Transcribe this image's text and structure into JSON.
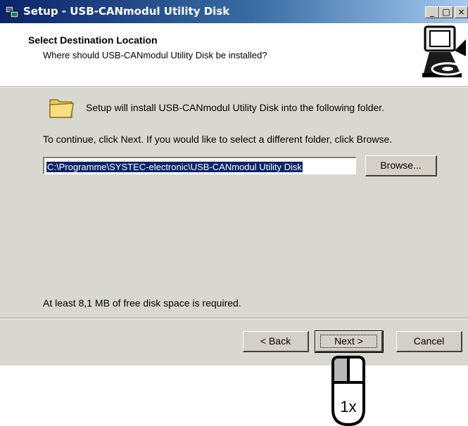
{
  "window": {
    "title": "Setup - USB-CANmodul Utility Disk",
    "controls": {
      "minimize": "_",
      "maximize": "□",
      "close": "×"
    },
    "app_icon": "setup-computer-icon"
  },
  "header": {
    "title": "Select Destination Location",
    "subtitle": "Where should USB-CANmodul Utility Disk be installed?",
    "logo_icon": "computer-disk-icon"
  },
  "content": {
    "folder_icon": "folder-icon",
    "install_text": "Setup will install USB-CANmodul Utility Disk into the following folder.",
    "continue_text": "To continue, click Next. If you would like to select a different folder, click Browse.",
    "path_value": "C:\\Programme\\SYSTEC-electronic\\USB-CANmodul Utility Disk",
    "browse_label": "Browse...",
    "space_text": "At least 8,1 MB of free disk space is required."
  },
  "footer": {
    "back_label": "< Back",
    "next_label": "Next >",
    "cancel_label": "Cancel"
  },
  "annotation": {
    "mouse_icon": "mouse-left-click-icon",
    "click_count": "1x"
  }
}
